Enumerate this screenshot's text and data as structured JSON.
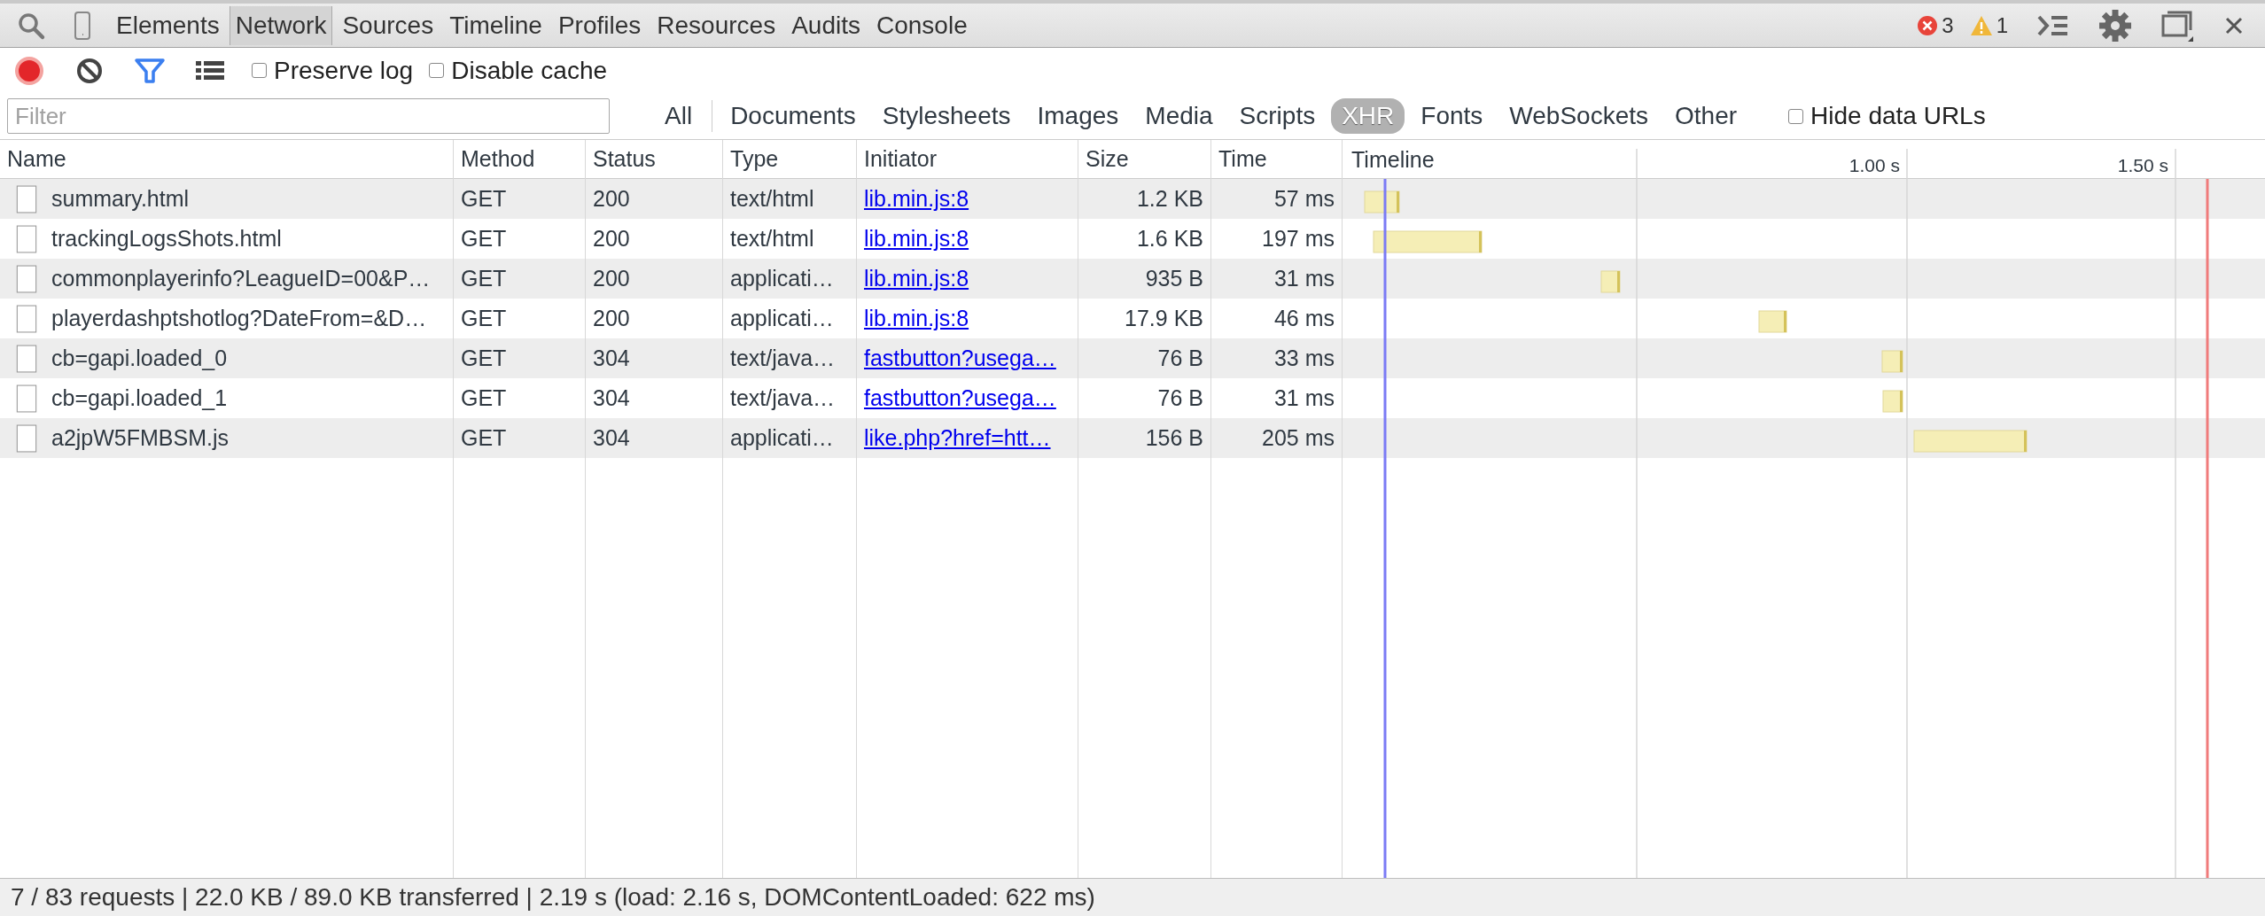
{
  "panel_tabs": [
    {
      "label": "Elements",
      "selected": false
    },
    {
      "label": "Network",
      "selected": true
    },
    {
      "label": "Sources",
      "selected": false
    },
    {
      "label": "Timeline",
      "selected": false
    },
    {
      "label": "Profiles",
      "selected": false
    },
    {
      "label": "Resources",
      "selected": false
    },
    {
      "label": "Audits",
      "selected": false
    },
    {
      "label": "Console",
      "selected": false
    }
  ],
  "counters": {
    "errors": "3",
    "warnings": "1"
  },
  "toolbar": {
    "recording": true,
    "filter_on": true,
    "preserve_log": {
      "label": "Preserve log",
      "checked": false
    },
    "disable_cache": {
      "label": "Disable cache",
      "checked": false
    }
  },
  "filter": {
    "placeholder": "Filter"
  },
  "type_filters": [
    {
      "label": "All",
      "selected": false
    },
    {
      "label": "Documents",
      "selected": false
    },
    {
      "label": "Stylesheets",
      "selected": false
    },
    {
      "label": "Images",
      "selected": false
    },
    {
      "label": "Media",
      "selected": false
    },
    {
      "label": "Scripts",
      "selected": false
    },
    {
      "label": "XHR",
      "selected": true
    },
    {
      "label": "Fonts",
      "selected": false
    },
    {
      "label": "WebSockets",
      "selected": false
    },
    {
      "label": "Other",
      "selected": false
    }
  ],
  "hide_data_urls": {
    "label": "Hide data URLs",
    "checked": false
  },
  "table": {
    "columns": [
      {
        "label": "Name",
        "kind": "file"
      },
      {
        "label": "Method",
        "kind": "text"
      },
      {
        "label": "Status",
        "kind": "text"
      },
      {
        "label": "Type",
        "kind": "text"
      },
      {
        "label": "Initiator",
        "kind": "link"
      },
      {
        "label": "Size",
        "kind": "number"
      },
      {
        "label": "Time",
        "kind": "number"
      }
    ],
    "rows": [
      {
        "cells": [
          "summary.html",
          "GET",
          "200",
          "text/html",
          "lib.min.js:8",
          "1.2 KB",
          "57 ms"
        ]
      },
      {
        "cells": [
          "trackingLogsShots.html",
          "GET",
          "200",
          "text/html",
          "lib.min.js:8",
          "1.6 KB",
          "197 ms"
        ]
      },
      {
        "cells": [
          "commonplayerinfo?LeagueID=00&P…",
          "GET",
          "200",
          "applicati…",
          "lib.min.js:8",
          "935 B",
          "31 ms"
        ]
      },
      {
        "cells": [
          "playerdashptshotlog?DateFrom=&D…",
          "GET",
          "200",
          "applicati…",
          "lib.min.js:8",
          "17.9 KB",
          "46 ms"
        ]
      },
      {
        "cells": [
          "cb=gapi.loaded_0",
          "GET",
          "304",
          "text/java…",
          "fastbutton?usega…",
          "76 B",
          "33 ms"
        ]
      },
      {
        "cells": [
          "cb=gapi.loaded_1",
          "GET",
          "304",
          "text/java…",
          "fastbutton?usega…",
          "76 B",
          "31 ms"
        ]
      },
      {
        "cells": [
          "a2jpW5FMBSM.js",
          "GET",
          "304",
          "applicati…",
          "like.php?href=htt…",
          "156 B",
          "205 ms"
        ]
      }
    ],
    "timeline": {
      "label": "Timeline",
      "tick_labels": [
        "1.00 s",
        "1.50 s"
      ]
    }
  },
  "status_bar": "7 / 83 requests | 22.0 KB / 89.0 KB transferred | 2.19 s (load: 2.16 s, DOMContentLoaded: 622 ms)"
}
